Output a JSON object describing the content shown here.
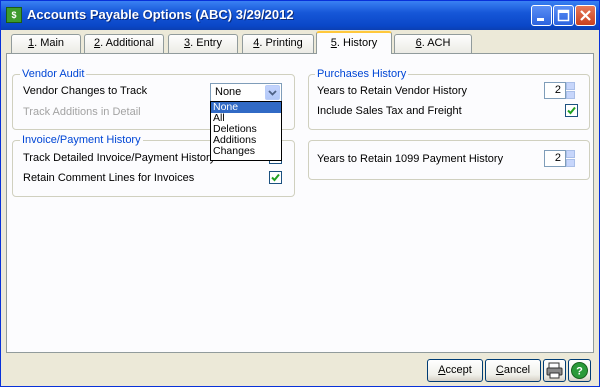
{
  "window": {
    "title": "Accounts Payable Options (ABC) 3/29/2012",
    "icon": "app-ledger-icon"
  },
  "tabs": [
    {
      "num": "1",
      "label": ". Main"
    },
    {
      "num": "2",
      "label": ". Additional"
    },
    {
      "num": "3",
      "label": ". Entry"
    },
    {
      "num": "4",
      "label": ". Printing"
    },
    {
      "num": "5",
      "label": ". History"
    },
    {
      "num": "6",
      "label": ". ACH"
    }
  ],
  "active_tab": "5. History",
  "vendor_audit": {
    "title": "Vendor Audit",
    "changes_label": "Vendor Changes to Track",
    "changes_value": "None",
    "changes_options": [
      "None",
      "All",
      "Deletions",
      "Additions",
      "Changes"
    ],
    "track_additions_label": "Track Additions in Detail"
  },
  "invoice_history": {
    "title": "Invoice/Payment History",
    "track_detailed_label": "Track Detailed Invoice/Payment History",
    "retain_comment_label": "Retain Comment Lines for Invoices",
    "retain_comment_checked": true
  },
  "purchases_history": {
    "title": "Purchases History",
    "years_vendor_label": "Years to Retain Vendor History",
    "years_vendor_value": "2",
    "include_tax_label": "Include Sales Tax and Freight",
    "include_tax_checked": true
  },
  "form1099": {
    "years_label": "Years to Retain 1099 Payment History",
    "years_value": "2"
  },
  "footer": {
    "accept_u": "A",
    "accept_rest": "ccept",
    "cancel_u": "C",
    "cancel_rest": "ancel",
    "print_icon": "printer-icon",
    "help_icon": "help-icon"
  },
  "colors": {
    "group_title": "#0046d5",
    "titlebar": "#0a47c8",
    "selection": "#316ac5",
    "check": "#21a121"
  }
}
